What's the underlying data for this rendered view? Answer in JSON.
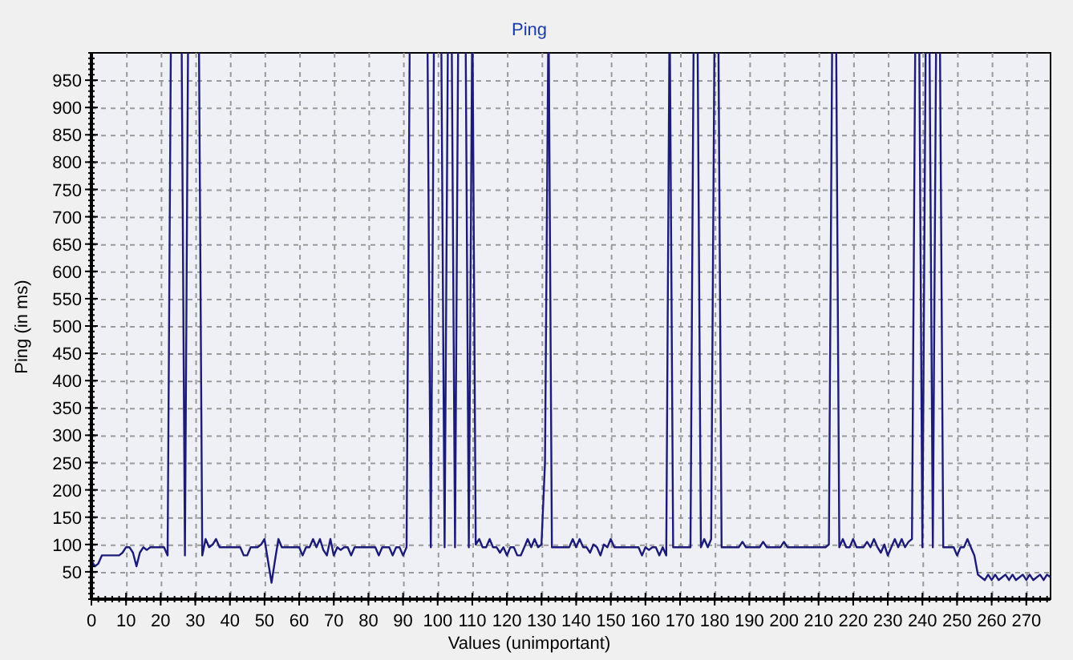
{
  "chart_data": {
    "type": "line",
    "title": "Ping",
    "xlabel": "Values (unimportant)",
    "ylabel": "Ping (in ms)",
    "grid": true,
    "xlim": [
      0,
      277
    ],
    "ylim": [
      0,
      1000
    ],
    "x": [
      0,
      1,
      2,
      3,
      4,
      5,
      6,
      7,
      8,
      9,
      10,
      11,
      12,
      13,
      14,
      15,
      16,
      17,
      18,
      19,
      20,
      21,
      22,
      23,
      24,
      25,
      26,
      27,
      28,
      29,
      30,
      31,
      32,
      33,
      34,
      35,
      36,
      37,
      38,
      39,
      40,
      41,
      42,
      43,
      44,
      45,
      46,
      47,
      48,
      49,
      50,
      51,
      52,
      53,
      54,
      55,
      56,
      57,
      58,
      59,
      60,
      61,
      62,
      63,
      64,
      65,
      66,
      67,
      68,
      69,
      70,
      71,
      72,
      73,
      74,
      75,
      76,
      77,
      78,
      79,
      80,
      81,
      82,
      83,
      84,
      85,
      86,
      87,
      88,
      89,
      90,
      91,
      92,
      93,
      94,
      95,
      96,
      97,
      98,
      99,
      100,
      101,
      102,
      103,
      104,
      105,
      106,
      107,
      108,
      109,
      110,
      111,
      112,
      113,
      114,
      115,
      116,
      117,
      118,
      119,
      120,
      121,
      122,
      123,
      124,
      125,
      126,
      127,
      128,
      129,
      130,
      131,
      132,
      133,
      134,
      135,
      136,
      137,
      138,
      139,
      140,
      141,
      142,
      143,
      144,
      145,
      146,
      147,
      148,
      149,
      150,
      151,
      152,
      153,
      154,
      155,
      156,
      157,
      158,
      159,
      160,
      161,
      162,
      163,
      164,
      165,
      166,
      167,
      168,
      169,
      170,
      171,
      172,
      173,
      174,
      175,
      176,
      177,
      178,
      179,
      180,
      181,
      182,
      183,
      184,
      185,
      186,
      187,
      188,
      189,
      190,
      191,
      192,
      193,
      194,
      195,
      196,
      197,
      198,
      199,
      200,
      201,
      202,
      203,
      204,
      205,
      206,
      207,
      208,
      209,
      210,
      211,
      212,
      213,
      214,
      215,
      216,
      217,
      218,
      219,
      220,
      221,
      222,
      223,
      224,
      225,
      226,
      227,
      228,
      229,
      230,
      231,
      232,
      233,
      234,
      235,
      236,
      237,
      238,
      239,
      240,
      241,
      242,
      243,
      244,
      245,
      246,
      247,
      248,
      249,
      250,
      251,
      252,
      253,
      254,
      255,
      256,
      257,
      258,
      259,
      260,
      261,
      262,
      263,
      264,
      265,
      266,
      267,
      268,
      269,
      270,
      271,
      272,
      273,
      274,
      275,
      276,
      277
    ],
    "xticks": [
      0,
      10,
      20,
      30,
      40,
      50,
      60,
      70,
      80,
      90,
      100,
      110,
      120,
      130,
      140,
      150,
      160,
      170,
      180,
      190,
      200,
      210,
      220,
      230,
      240,
      250,
      260,
      270
    ],
    "yticks": [
      50,
      100,
      150,
      200,
      250,
      300,
      350,
      400,
      450,
      500,
      550,
      600,
      650,
      700,
      750,
      800,
      850,
      900,
      950
    ],
    "series": [
      {
        "color": "#1c1c78",
        "values": [
          70,
          60,
          65,
          80,
          80,
          80,
          80,
          80,
          80,
          85,
          95,
          95,
          85,
          60,
          85,
          95,
          90,
          95,
          95,
          95,
          95,
          95,
          80,
          null,
          null,
          null,
          null,
          80,
          null,
          null,
          null,
          null,
          80,
          110,
          95,
          100,
          110,
          95,
          95,
          95,
          95,
          95,
          95,
          95,
          80,
          80,
          95,
          95,
          95,
          100,
          110,
          70,
          30,
          70,
          110,
          95,
          95,
          95,
          95,
          95,
          95,
          80,
          95,
          95,
          110,
          95,
          110,
          90,
          80,
          110,
          80,
          95,
          90,
          95,
          95,
          80,
          95,
          95,
          95,
          95,
          95,
          95,
          95,
          80,
          95,
          95,
          95,
          80,
          95,
          95,
          80,
          95,
          null,
          null,
          null,
          null,
          null,
          null,
          95,
          null,
          null,
          null,
          95,
          null,
          null,
          95,
          null,
          null,
          null,
          95,
          null,
          100,
          110,
          95,
          95,
          110,
          95,
          95,
          85,
          95,
          80,
          95,
          95,
          80,
          80,
          95,
          110,
          95,
          110,
          95,
          100,
          250,
          null,
          95,
          95,
          95,
          95,
          95,
          95,
          110,
          95,
          110,
          95,
          95,
          85,
          100,
          95,
          80,
          100,
          95,
          110,
          95,
          95,
          95,
          95,
          95,
          95,
          95,
          95,
          80,
          95,
          90,
          95,
          95,
          80,
          95,
          80,
          null,
          95,
          95,
          95,
          95,
          95,
          95,
          null,
          null,
          95,
          110,
          95,
          110,
          null,
          null,
          95,
          95,
          95,
          95,
          95,
          95,
          105,
          95,
          95,
          95,
          95,
          95,
          105,
          95,
          95,
          95,
          95,
          95,
          105,
          95,
          95,
          95,
          95,
          95,
          95,
          95,
          95,
          95,
          95,
          95,
          95,
          100,
          null,
          null,
          95,
          110,
          95,
          95,
          110,
          95,
          95,
          95,
          105,
          95,
          110,
          95,
          85,
          100,
          80,
          95,
          110,
          95,
          110,
          95,
          105,
          110,
          null,
          null,
          95,
          null,
          null,
          95,
          null,
          null,
          95,
          95,
          95,
          95,
          80,
          95,
          95,
          110,
          95,
          80,
          45,
          40,
          35,
          45,
          35,
          45,
          35,
          40,
          45,
          35,
          45,
          35,
          40,
          45,
          35,
          45,
          35,
          40,
          45,
          35,
          45,
          40
        ]
      }
    ]
  }
}
